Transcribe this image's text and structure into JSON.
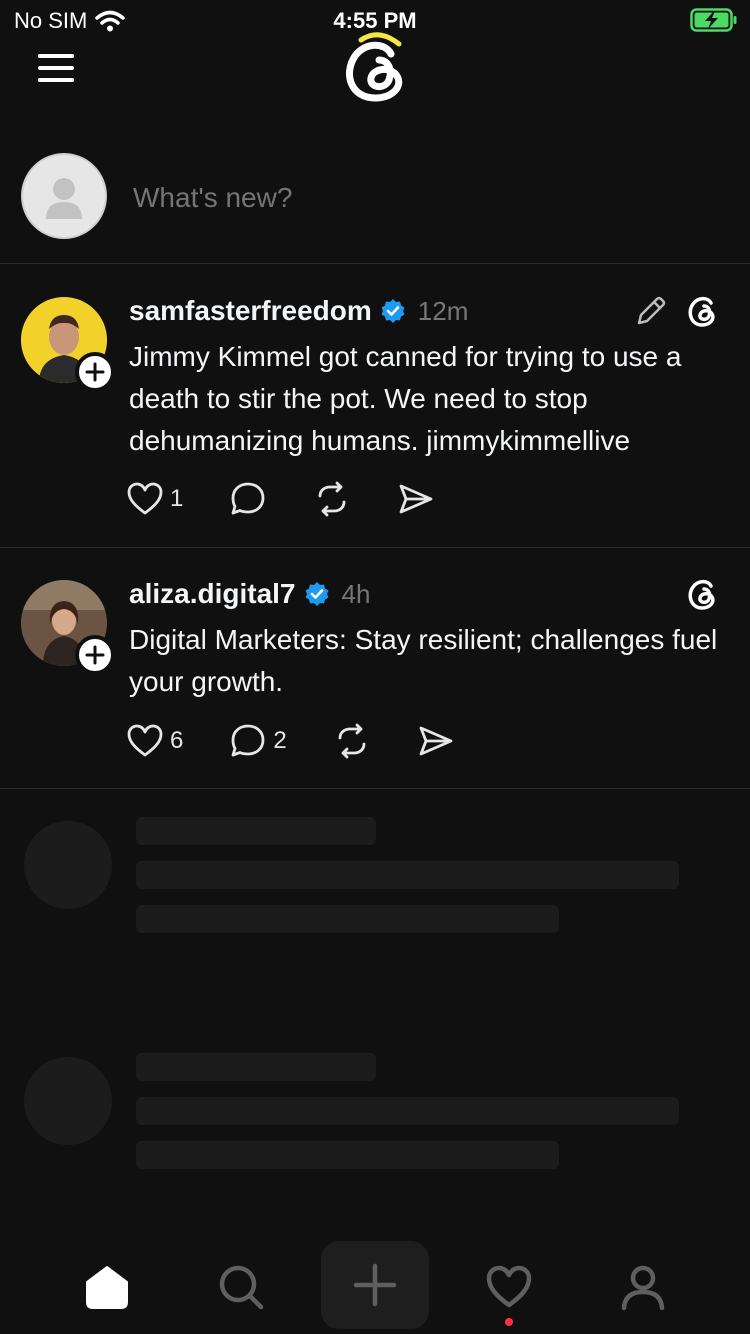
{
  "status_bar": {
    "carrier": "No SIM",
    "time": "4:55 PM"
  },
  "composer": {
    "placeholder": "What's new?"
  },
  "posts": [
    {
      "username": "samfasterfreedom",
      "verified": true,
      "time": "12m",
      "text": "Jimmy Kimmel got canned for trying to use a death to stir the pot. We need to stop dehumanizing humans. jimmykimmellive",
      "likes": "1",
      "replies": "",
      "show_edit": true
    },
    {
      "username": "aliza.digital7",
      "verified": true,
      "time": "4h",
      "text": "Digital Marketers: Stay resilient; challenges fuel your growth.",
      "likes": "6",
      "replies": "2",
      "show_edit": false
    }
  ],
  "colors": {
    "background": "#101010",
    "verified_blue": "#1d9bf0",
    "battery_green": "#4cd964",
    "notification_red": "#ff3040",
    "logo_accent": "#f5e642"
  },
  "tab_bar": {
    "items": [
      "home-icon",
      "search-icon",
      "create-icon",
      "activity-icon",
      "profile-icon"
    ],
    "active": "home-icon"
  }
}
